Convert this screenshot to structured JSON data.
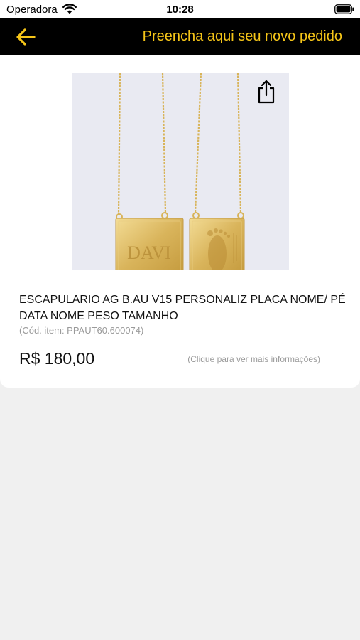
{
  "status_bar": {
    "carrier": "Operadora",
    "time": "10:28"
  },
  "nav": {
    "title": "Preencha aqui seu novo pedido",
    "back_icon": "arrow-left-icon",
    "accent_color": "#f5c518",
    "background_color": "#000000"
  },
  "product": {
    "image_label": "DAVI",
    "name": "ESCAPULARIO AG B.AU V15 PERSONALIZ PLACA NOME/ PÉ DATA NOME PESO TAMANHO",
    "code": "(Cód. item: PPAUT60.600074)",
    "price": "R$ 180,00",
    "more_info": "(Clique para ver mais informações)",
    "share_icon": "share-icon"
  }
}
